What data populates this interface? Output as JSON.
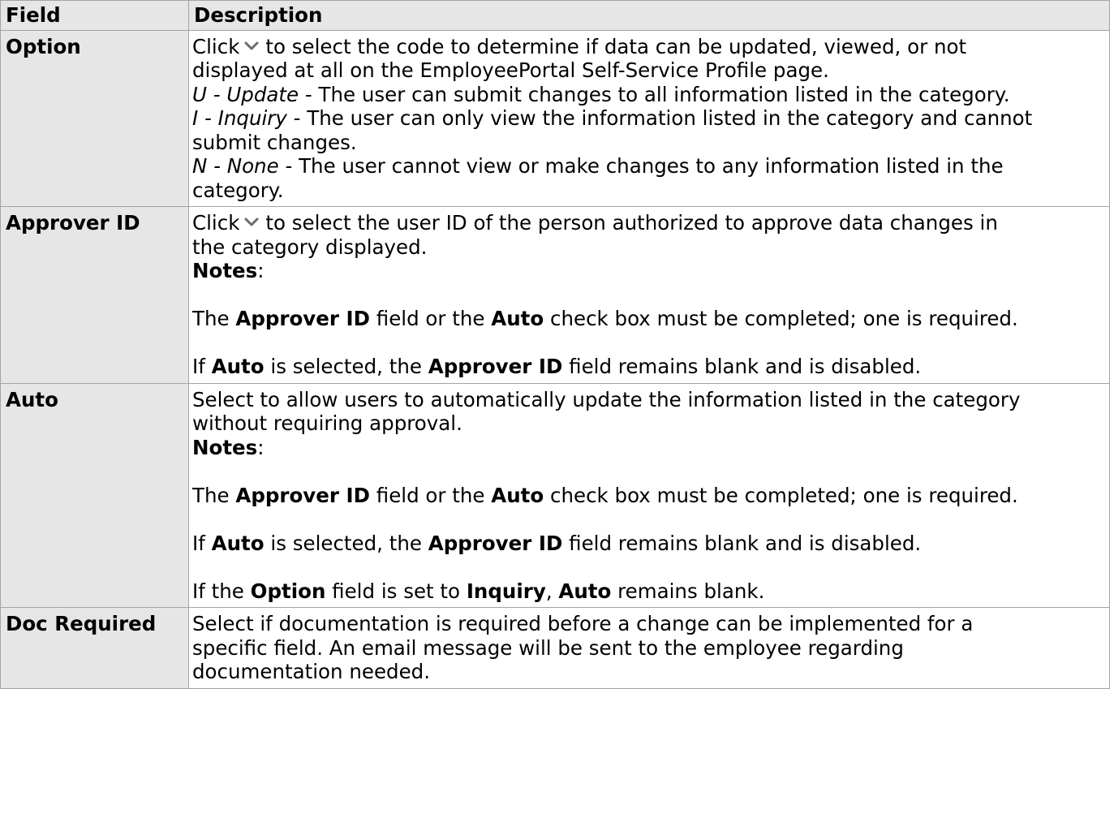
{
  "header": {
    "field": "Field",
    "description": "Description"
  },
  "common": {
    "click": "Click",
    "notes": "Notes",
    "approver_id": "Approver ID",
    "auto": "Auto",
    "colon": ":",
    "req_mid": " field or the ",
    "req_end": " check box must be completed; one is required.",
    "the": "The ",
    "if": "If ",
    "blank_mid": " is selected, the ",
    "blank_end": " field remains blank and is disabled."
  },
  "rows": {
    "option": {
      "field": "Option",
      "line1": "to select the code to determine if data can be updated, viewed, or not",
      "line2": "displayed at all on the EmployeePortal Self-Service Profile page.",
      "u_code": "U - Update",
      "u_text": " - The user can submit changes to all information listed in the category.",
      "i_code": "I - Inquiry",
      "i_text": " - The user can only view the information listed in the category and cannot",
      "i_text2": "submit changes.",
      "n_code": "N - None",
      "n_text": " - The user cannot view or make changes to any information listed in the",
      "n_text2": "category."
    },
    "approver": {
      "field": "Approver ID",
      "line1": "to select the user ID of the person authorized to approve data changes in",
      "line2": "the category displayed."
    },
    "auto": {
      "field": "Auto",
      "line1": "Select to allow users to automatically update the information listed in the category",
      "line2": "without requiring approval.",
      "opt_pre": "If the ",
      "opt_field": "Option",
      "opt_mid": " field is set to ",
      "opt_val": "Inquiry",
      "opt_sep": ", ",
      "opt_auto": "Auto",
      "opt_end": " remains blank."
    },
    "doc": {
      "field": "Doc Required",
      "line1": "Select if documentation is required before a change can be implemented for a",
      "line2": "specific field. An email message will be sent to the employee regarding",
      "line3": "documentation needed."
    }
  },
  "icons": {
    "chevron": "chevron-down-icon"
  },
  "colors": {
    "border": "#a3a3a3",
    "header_bg": "#e6e6e6",
    "chevron": "#6b6b6b"
  }
}
